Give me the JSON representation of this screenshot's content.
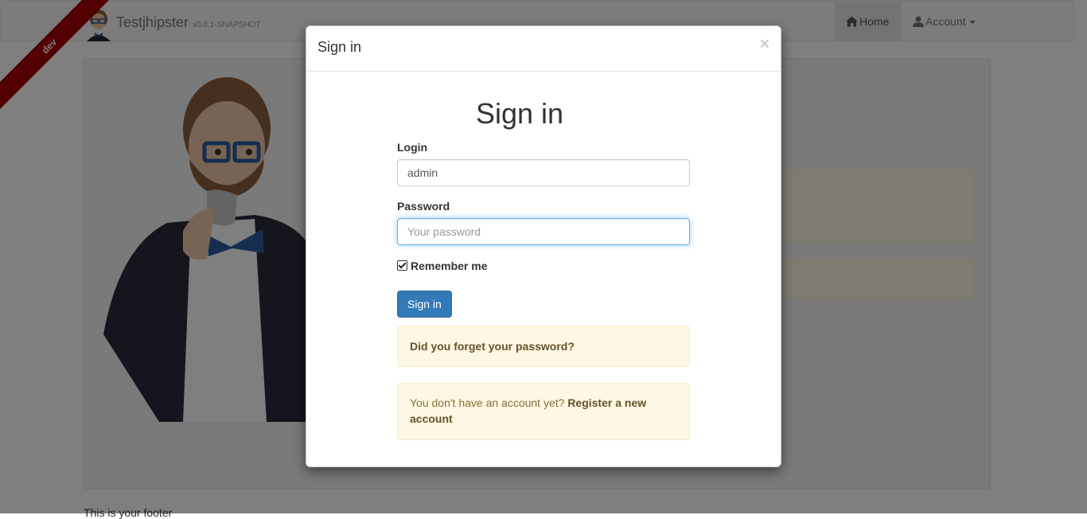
{
  "navbar": {
    "brand_name": "Testjhipster",
    "brand_version": "v0.0.1-SNAPSHOT",
    "home_label": "Home",
    "account_label": "Account"
  },
  "ribbon": {
    "label": "dev"
  },
  "footer": {
    "text": "This is your footer"
  },
  "modal": {
    "header_title": "Sign in",
    "close_label": "×",
    "page_title": "Sign in",
    "login_label": "Login",
    "login_value": "admin",
    "password_label": "Password",
    "password_placeholder": "Your password",
    "remember_label": "Remember me",
    "remember_checked": true,
    "submit_label": "Sign in",
    "forgot_password_link": "Did you forget your password?",
    "register_prompt": "You don't have an account yet?",
    "register_link": "Register a new account"
  },
  "colors": {
    "primary": "#337ab7",
    "warning_bg": "#fcf8e3",
    "warning_text": "#8a6d3b",
    "ribbon": "#aa0000",
    "focus_border": "#66afe9"
  }
}
